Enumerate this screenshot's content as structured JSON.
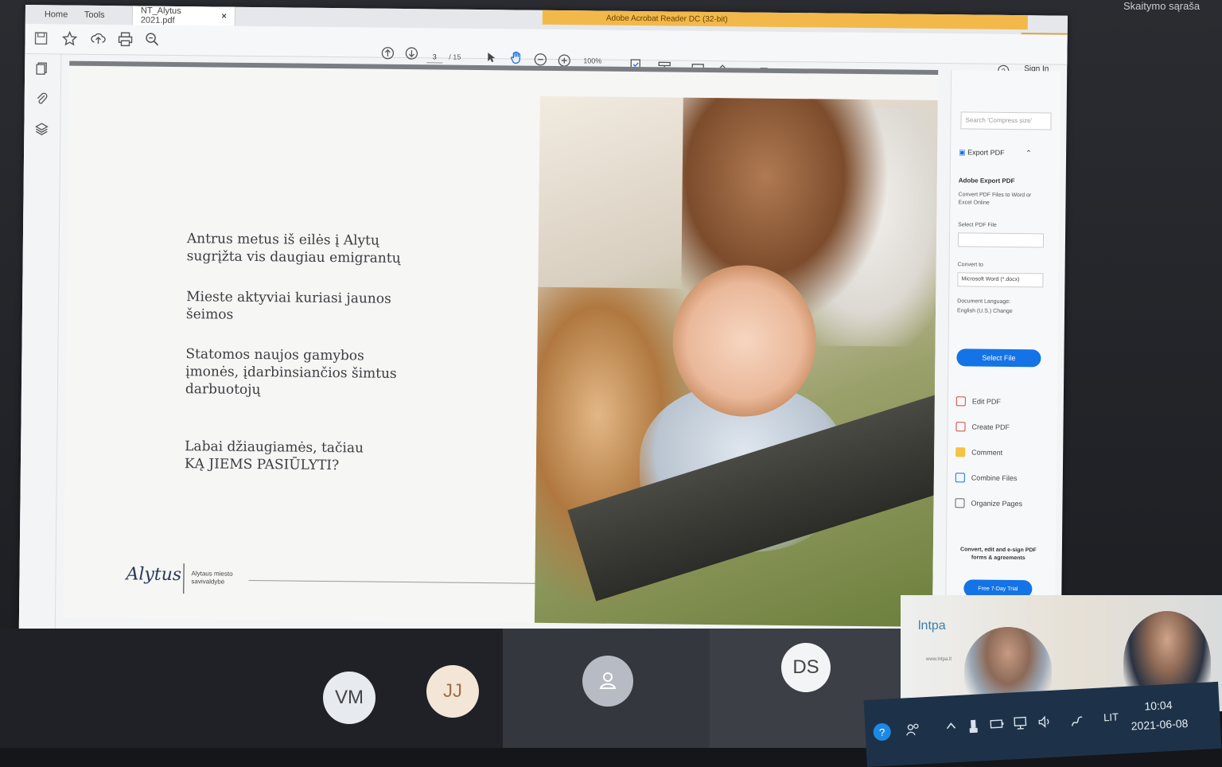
{
  "app": {
    "name": "Adobe Acrobat Reader DC (32-bit)",
    "tabs": [
      "Home",
      "Tools"
    ],
    "document_tab": "NT_Alytus 2021.pdf",
    "close_glyph": "×",
    "window_controls": [
      "–",
      "▫",
      "×"
    ]
  },
  "toolbar": {
    "page_current": "3",
    "page_total": "/ 15",
    "zoom": "100%",
    "sign_in": "Sign In"
  },
  "document": {
    "paragraphs": [
      [
        "Antrus metus iš eilės į Alytų",
        "sugrįžta vis daugiau emigrantų"
      ],
      [
        "Mieste aktyviai kuriasi jaunos",
        "šeimos"
      ],
      [
        "Statomos naujos gamybos",
        "įmonės, įdarbinsiančios šimtus",
        "darbuotojų"
      ],
      [
        "Labai džiaugiamės, tačiau",
        "KĄ JIEMS PASIŪLYTI?"
      ]
    ],
    "footer_logo": "Alytus",
    "footer_org": [
      "Alytaus miesto",
      "savivaldybė"
    ]
  },
  "right_panel": {
    "search_placeholder": "Search 'Compress size'",
    "export_header": "Export PDF",
    "adobe_export": "Adobe Export PDF",
    "convert_desc": "Convert PDF Files to Word or Excel Online",
    "select_pdf": "Select PDF File",
    "convert_to": "Convert to",
    "convert_value": "Microsoft Word (*.docx)",
    "doc_lang": "Document Language:",
    "doc_lang_value": "English (U.S.) Change",
    "select_file": "Select File",
    "tools": [
      "Edit PDF",
      "Create PDF",
      "Comment",
      "Combine Files",
      "Organize Pages"
    ],
    "promo": "Convert, edit and e-sign PDF forms & agreements",
    "trial": "Free 7-Day Trial"
  },
  "meeting": {
    "participants": [
      "VM",
      "JJ",
      "DS"
    ],
    "org_name": "lntpa",
    "org_url": "www.lntpa.lt"
  },
  "taskbar": {
    "help_glyph": "?",
    "lang": "LIT",
    "time": "10:04",
    "date": "2021-06-08"
  },
  "browser": {
    "reading_list": "Skaitymo sąraša"
  },
  "icons": [
    "save-icon",
    "star-icon",
    "upload-icon",
    "print-icon",
    "zoom-icon",
    "arrow-up-icon",
    "arrow-down-icon",
    "cursor-icon",
    "hand-icon",
    "zoom-out-icon",
    "zoom-in-icon",
    "comment-icon",
    "pen-icon",
    "sign-icon",
    "pages-icon",
    "attachment-icon",
    "layers-icon"
  ]
}
